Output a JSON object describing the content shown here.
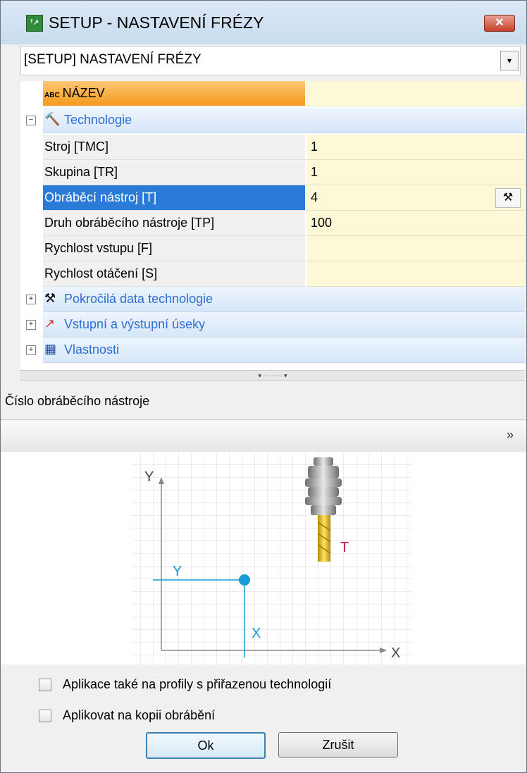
{
  "window": {
    "title": "SETUP - NASTAVENÍ FRÉZY",
    "close_label": "✕",
    "app_icon_label": "ᵀ↗"
  },
  "dropdown": {
    "value": "[SETUP] NASTAVENÍ FRÉZY",
    "arrow": "▾"
  },
  "grid": {
    "name_row": {
      "badge": "ABC",
      "label": "NÁZEV",
      "value": ""
    },
    "technology": {
      "label": "Technologie",
      "expander": "−",
      "rows": [
        {
          "label": "Stroj [TMC]",
          "value": "1"
        },
        {
          "label": "Skupina [TR]",
          "value": "1"
        },
        {
          "label": "Obráběcí nástroj [T]",
          "value": "4"
        },
        {
          "label": "Druh obráběcího nástroje [TP]",
          "value": "100"
        },
        {
          "label": "Rychlost vstupu [F]",
          "value": ""
        },
        {
          "label": "Rychlost otáčení [S]",
          "value": ""
        }
      ]
    },
    "categories": [
      {
        "label": "Pokročilá data technologie",
        "expander": "+",
        "icon": "⚒"
      },
      {
        "label": "Vstupní a výstupní úseky",
        "expander": "+",
        "icon": "↗"
      },
      {
        "label": "Vlastnosti",
        "expander": "+",
        "icon": "▦"
      }
    ],
    "tool_button": "⚒"
  },
  "splitter": "▾ ········· ▾",
  "description": "Číslo obráběcího nástroje",
  "collapse_chevron": "»",
  "preview": {
    "axis_y": "Y",
    "axis_x": "X",
    "point_y": "Y",
    "point_x": "X",
    "tool_label": "T"
  },
  "checkboxes": [
    {
      "label": "Aplikace také na profily s přiřazenou technologií",
      "checked": false
    },
    {
      "label": "Aplikovat na kopii obrábění",
      "checked": false
    }
  ],
  "buttons": {
    "ok": "Ok",
    "cancel": "Zrušit"
  },
  "colors": {
    "selected": "#2a7bd7",
    "name_row": "#f39a1b",
    "value_bg": "#fdf8d8",
    "category_text": "#2d6fd3",
    "axis_blue": "#1a9ad6",
    "tool_red": "#b0203a"
  }
}
